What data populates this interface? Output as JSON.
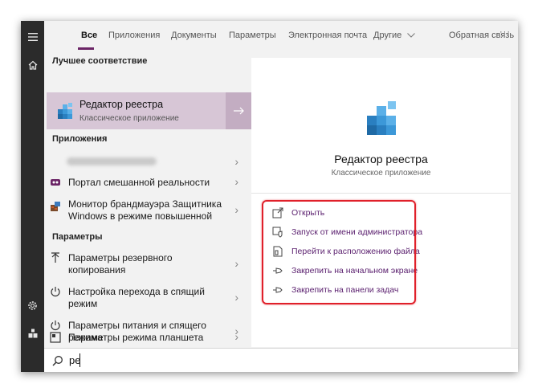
{
  "rail": {
    "menu_icon": "hamburger-icon",
    "home_icon": "home-icon",
    "settings_icon": "gear-icon",
    "user_icon": "user-icon"
  },
  "tabs": [
    {
      "label": "Все",
      "active": true
    },
    {
      "label": "Приложения"
    },
    {
      "label": "Документы"
    },
    {
      "label": "Параметры"
    },
    {
      "label": "Электронная почта"
    },
    {
      "label": "Другие"
    }
  ],
  "feedback_label": "Обратная связь",
  "more_label": "···",
  "best_match": {
    "header": "Лучшее соответствие",
    "title": "Редактор реестра",
    "subtitle": "Классическое приложение"
  },
  "apps_section": {
    "header": "Приложения",
    "items": [
      {
        "label": ""
      },
      {
        "label": "Портал смешанной реальности"
      },
      {
        "label": "Монитор брандмауэра Защитника Windows в режиме повышенной"
      }
    ]
  },
  "settings_section": {
    "header": "Параметры",
    "items": [
      {
        "label": "Параметры резервного копирования"
      },
      {
        "label": "Настройка перехода в спящий режим"
      },
      {
        "label": "Параметры питания и спящего режима"
      },
      {
        "label": "Параметры режима планшета"
      }
    ]
  },
  "details": {
    "title": "Редактор реестра",
    "subtitle": "Классическое приложение",
    "actions": [
      {
        "label": "Открыть",
        "icon": "open-icon"
      },
      {
        "label": "Запуск от имени администратора",
        "icon": "run-as-admin-icon"
      },
      {
        "label": "Перейти к расположению файла",
        "icon": "file-location-icon"
      },
      {
        "label": "Закрепить на начальном экране",
        "icon": "pin-icon"
      },
      {
        "label": "Закрепить на панели задач",
        "icon": "pin-icon"
      }
    ]
  },
  "search": {
    "query": "ре"
  },
  "colors": {
    "rail": "#2b2b2b",
    "accent": "#6b2566",
    "selection": "#d7c6d6",
    "highlight_border": "#e0202a",
    "action_text": "#5a1f6e"
  }
}
